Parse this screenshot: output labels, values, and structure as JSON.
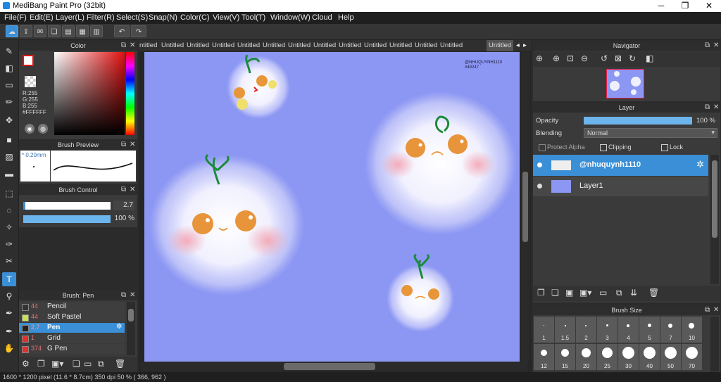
{
  "window": {
    "title": "MediBang Paint Pro (32bit)",
    "minimize": "─",
    "maximize": "❐",
    "close": "✕"
  },
  "menu": [
    "File(F)",
    "Edit(E)",
    "Layer(L)",
    "Filter(R)",
    "Select(S)",
    "Snap(N)",
    "Color(C)",
    "View(V)",
    "Tool(T)",
    "Window(W)",
    "Cloud",
    "Help"
  ],
  "toolbar": {
    "cloud": "☁",
    "upload": "⇪",
    "chat": "✉",
    "comment": "❏",
    "page": "▤",
    "pages": "▦",
    "grid": "▥",
    "undo": "↶",
    "redo": "↷"
  },
  "tools": [
    "✎",
    "◧",
    "▭",
    "✏",
    "✥",
    "■",
    "▨",
    "▬",
    "⬚",
    "◌",
    "✧",
    "✑",
    "✂",
    "T",
    "⚲",
    "✒",
    "✒",
    "✋"
  ],
  "color_panel": {
    "title": "Color",
    "r": "R:255",
    "g": "G:255",
    "b": "B:255",
    "hex": "#FFFFFF",
    "primary": "#ffffff",
    "accent": "#e01414"
  },
  "brush_preview": {
    "title": "Brush Preview",
    "size": "* 0.20mm"
  },
  "brush_control": {
    "title": "Brush Control",
    "size_value": "2.7",
    "opacity_value": "100 %",
    "opacity_fraction": 1.0
  },
  "brush_list": {
    "title": "Brush: Pen",
    "items": [
      {
        "size": "44",
        "name": "Pencil",
        "swatch": "#333333"
      },
      {
        "size": "44",
        "name": "Soft Pastel",
        "swatch": "#c8e05a"
      },
      {
        "size": "2.7",
        "name": "Pen",
        "swatch": "#222222"
      },
      {
        "size": "1",
        "name": "Grid",
        "swatch": "#e03030"
      },
      {
        "size": "374",
        "name": "G Pen",
        "swatch": "#e03030"
      }
    ]
  },
  "tabs": [
    "ntitled",
    "Untitled",
    "Untitled",
    "Untitled",
    "Untitled",
    "Untitled",
    "Untitled",
    "Untitled",
    "Untitled",
    "Untitled",
    "Untitled",
    "Untitled",
    "Untitled",
    "Untitled"
  ],
  "canvas": {
    "watermark_line1": "@NHUQUYNH1110",
    "watermark_line2": "#49247"
  },
  "navigator": {
    "title": "Navigator"
  },
  "layer_panel": {
    "title": "Layer",
    "opacity_label": "Opacity",
    "opacity_value": "100 %",
    "opacity_fraction": 1.0,
    "blending_label": "Blending",
    "blending_value": "Normal",
    "protect_alpha": "Protect Alpha",
    "clipping": "Clipping",
    "lock": "Lock",
    "layers": [
      {
        "name": "@nhuquynh1110",
        "selected": true
      },
      {
        "name": "Layer1",
        "selected": false
      }
    ]
  },
  "brush_size": {
    "title": "Brush Size",
    "row1": [
      "1",
      "1.5",
      "2",
      "3",
      "4",
      "5",
      "7",
      "10"
    ],
    "row2": [
      "12",
      "15",
      "20",
      "25",
      "30",
      "40",
      "50",
      "70"
    ]
  },
  "status": {
    "text": "1600 * 1200 pixel   (11.6 * 8.7cm)   350 dpi   50 %   ( 366, 962 )"
  },
  "colors": {
    "accent": "#3a8fd6",
    "canvas_bg": "#8c97f3",
    "cheek": "#f2a6b6",
    "face": "#e8943a",
    "leaf": "#1c8a3c"
  }
}
